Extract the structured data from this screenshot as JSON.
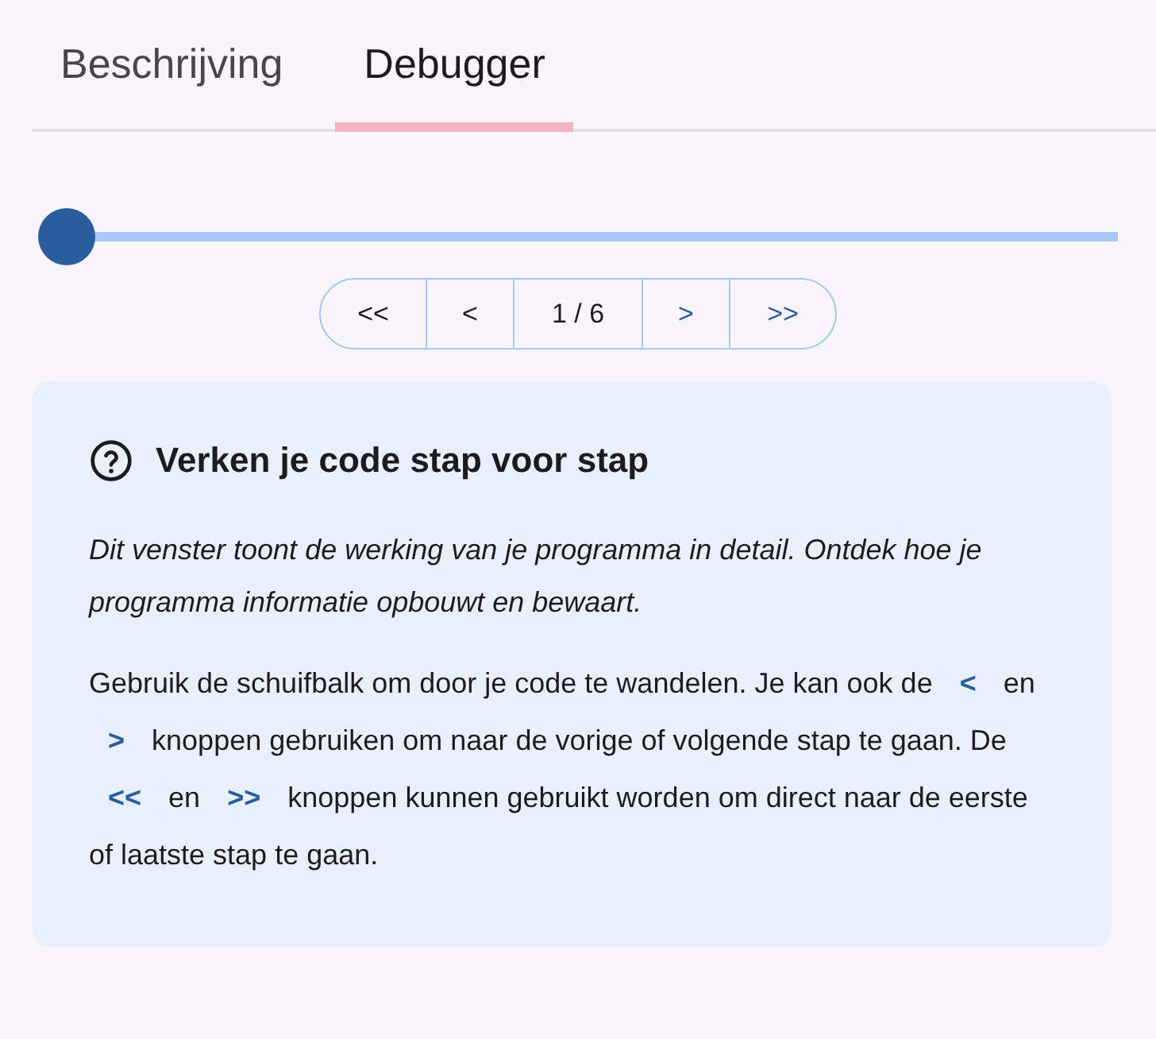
{
  "tabs": [
    {
      "label": "Beschrijving",
      "selected": false
    },
    {
      "label": "Debugger",
      "selected": true
    }
  ],
  "step_slider": {
    "level": 0
  },
  "step_nav": [
    {
      "kind": "button",
      "label": "<<",
      "disabled": true
    },
    {
      "kind": "button",
      "label": "<",
      "disabled": true
    },
    {
      "kind": "counter",
      "label": "1 / 6"
    },
    {
      "kind": "button",
      "label": ">",
      "disabled": false
    },
    {
      "kind": "button",
      "label": ">>",
      "disabled": false
    }
  ],
  "help_card": {
    "title": "Verken je code stap voor stap",
    "intro": "Dit venster toont de werking van je programma in detail. Ontdek hoe je programma informatie opbouwt en bewaart.",
    "paragraph": [
      {
        "kind": "text",
        "text": "Gebruik de schuifbalk om door je code te wandelen. Je kan ook de"
      },
      {
        "kind": "key",
        "text": "<"
      },
      {
        "kind": "text",
        "text": "en"
      },
      {
        "kind": "key",
        "text": ">"
      },
      {
        "kind": "text",
        "text": "knoppen gebruiken om naar de vorige of volgende stap te gaan. De"
      },
      {
        "kind": "key",
        "text": "<<"
      },
      {
        "kind": "text",
        "text": "en"
      },
      {
        "kind": "key",
        "text": ">>"
      },
      {
        "kind": "text",
        "text": "knoppen kunnen gebruikt worden om direct naar de eerste of laatste stap te gaan."
      }
    ]
  }
}
